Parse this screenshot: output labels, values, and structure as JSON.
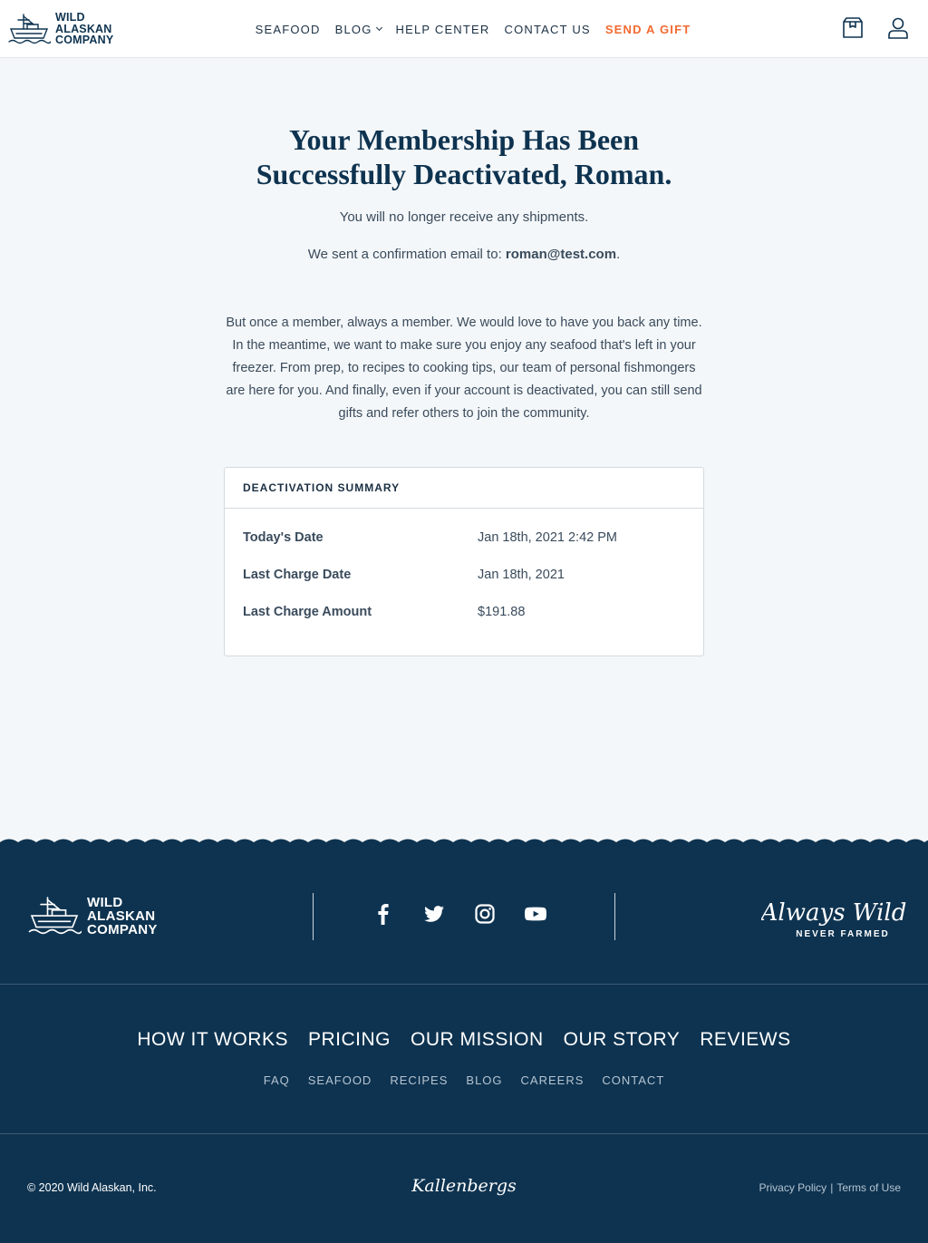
{
  "header": {
    "logo_lines": [
      "WILD",
      "ALASKAN",
      "COMPANY"
    ],
    "nav": [
      {
        "label": "SEAFOOD"
      },
      {
        "label": "BLOG"
      },
      {
        "label": "HELP CENTER"
      },
      {
        "label": "CONTACT US"
      },
      {
        "label": "SEND A GIFT"
      }
    ],
    "icons": [
      "box-icon",
      "user-icon"
    ]
  },
  "main": {
    "title_line1": "Your Membership Has Been",
    "title_line2": "Successfully Deactivated, Roman.",
    "shipments_text": "You will no longer receive any shipments.",
    "confirm_prefix": "We sent a confirmation email to: ",
    "confirm_email": "roman@test.com",
    "confirm_suffix": ".",
    "paragraph": "But once a member, always a member. We would love to have you back any time. In the meantime, we want to make sure you enjoy any seafood that's left in your freezer. From prep, to recipes to cooking tips, our team of personal fishmongers are here for you. And finally, even if your account is deactivated, you can still send gifts and refer others to join the community.",
    "summary": {
      "heading": "DEACTIVATION SUMMARY",
      "rows": [
        {
          "label": "Today's Date",
          "value": "Jan 18th, 2021 2:42 PM"
        },
        {
          "label": "Last Charge Date",
          "value": "Jan 18th, 2021"
        },
        {
          "label": "Last Charge Amount",
          "value": "$191.88"
        }
      ]
    }
  },
  "footer": {
    "logo_lines": [
      "WILD",
      "ALASKAN",
      "COMPANY"
    ],
    "social": [
      "facebook-icon",
      "twitter-icon",
      "instagram-icon",
      "youtube-icon"
    ],
    "tagline_script": "Always Wild",
    "tagline_sub": "NEVER FARMED",
    "primary_nav": [
      "HOW IT WORKS",
      "PRICING",
      "OUR MISSION",
      "OUR STORY",
      "REVIEWS"
    ],
    "secondary_nav": [
      "FAQ",
      "SEAFOOD",
      "RECIPES",
      "BLOG",
      "CAREERS",
      "CONTACT"
    ],
    "copyright": "© 2020 Wild Alaskan, Inc.",
    "brand_script": "Kallenbergs",
    "privacy": "Privacy Policy",
    "separator": "|",
    "terms": "Terms of Use"
  },
  "colors": {
    "navy": "#0e3350",
    "accent_orange": "#f26a32",
    "page_bg": "#f4f7f9"
  }
}
